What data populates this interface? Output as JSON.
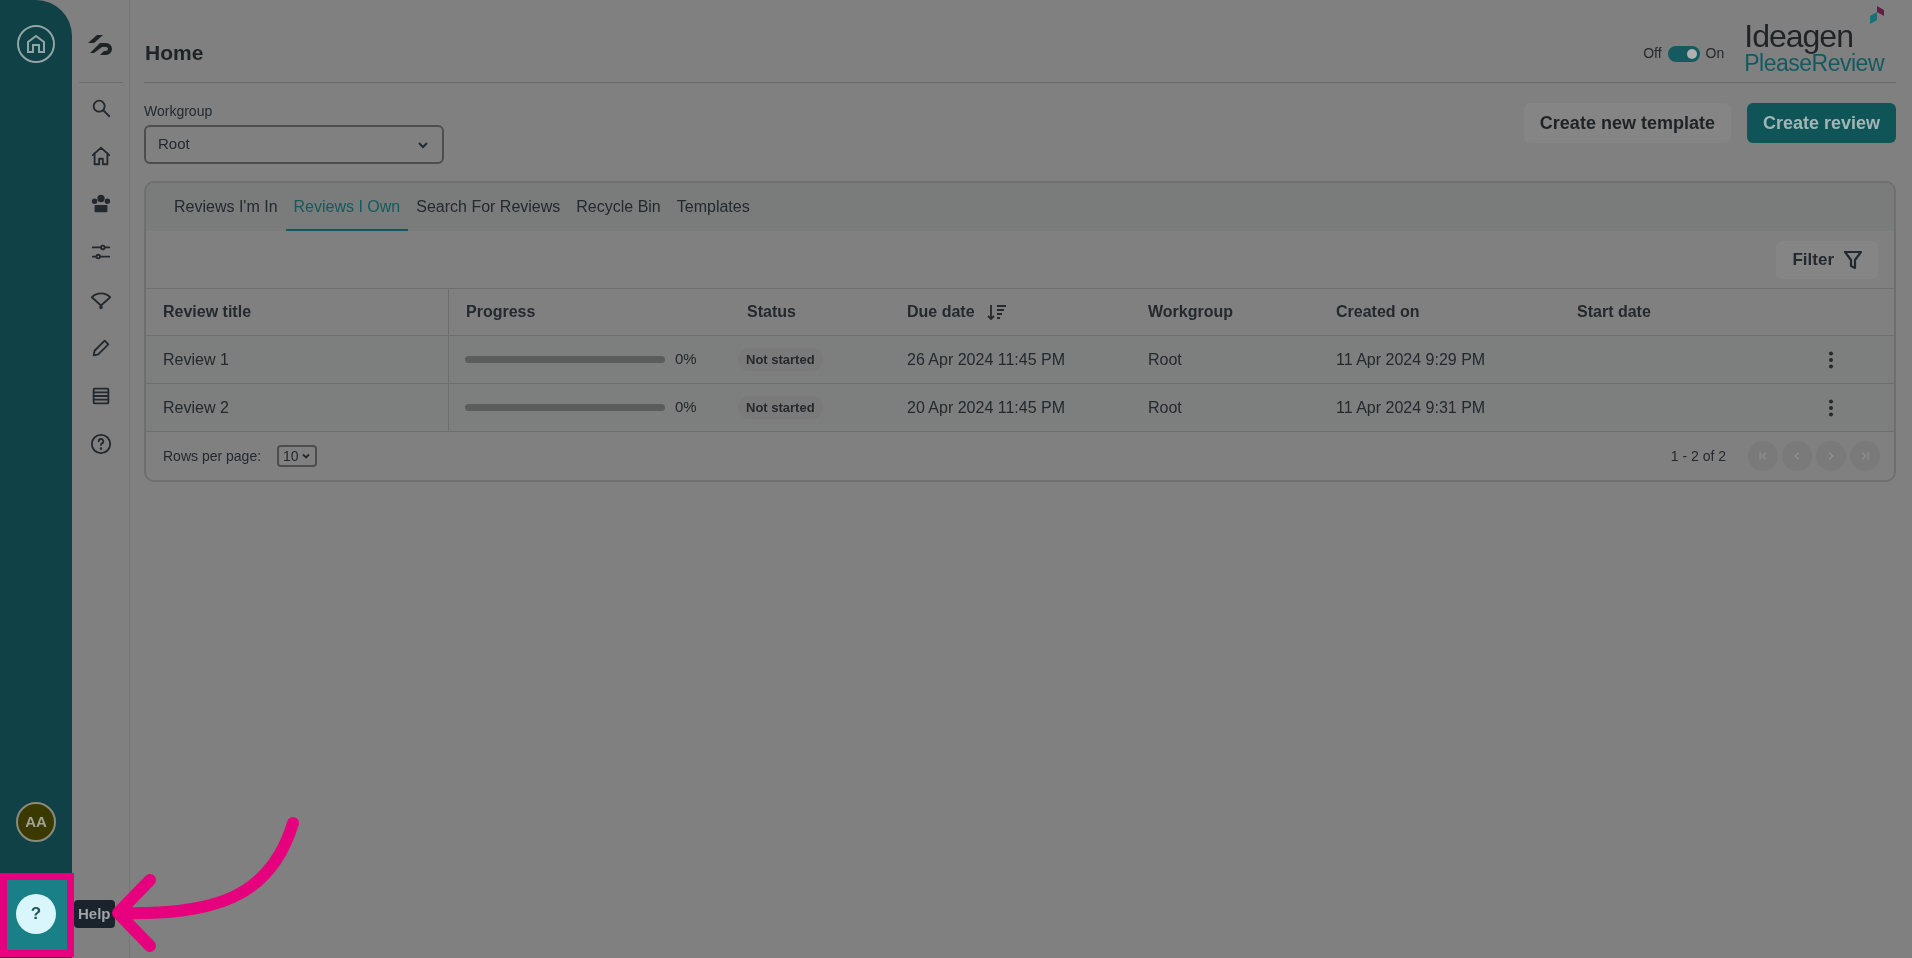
{
  "page": {
    "title": "Home"
  },
  "toggle": {
    "off_label": "Off",
    "on_label": "On",
    "on": true
  },
  "logo": {
    "brand": "Ideagen",
    "product": "PleaseReview"
  },
  "workgroup": {
    "label": "Workgroup",
    "value": "Root"
  },
  "buttons": [
    {
      "label": "Create new template",
      "kind": "secondary"
    },
    {
      "label": "Create review",
      "kind": "primary"
    }
  ],
  "tabs": [
    {
      "label": "Reviews I'm In",
      "selected": false
    },
    {
      "label": "Reviews I Own",
      "selected": true
    },
    {
      "label": "Search For Reviews",
      "selected": false
    },
    {
      "label": "Recycle Bin",
      "selected": false
    },
    {
      "label": "Templates",
      "selected": false
    }
  ],
  "filter": {
    "label": "Filter"
  },
  "table": {
    "columns": [
      "Review title",
      "Progress",
      "Status",
      "Due date",
      "Workgroup",
      "Created on",
      "Start date"
    ],
    "rows": [
      {
        "title": "Review 1",
        "level": 0,
        "progress": "0%",
        "status": "Not started",
        "due": "26 Apr 2024 11:45 PM",
        "workgroup": "Root",
        "created": "11 Apr 2024 9:29 PM"
      },
      {
        "title": "Review 2",
        "level": 0,
        "progress": "0%",
        "status": "Not started",
        "due": "20 Apr 2024 11:45 PM",
        "workgroup": "Root",
        "created": "11 Apr 2024 9:31 PM"
      }
    ]
  },
  "pagination": {
    "rows_label": "Rows per page:",
    "rows_value": "10",
    "range": "1 - 2 of 2"
  },
  "user": {
    "initials": "AA"
  },
  "help": {
    "label": "?",
    "tooltip": "Help"
  }
}
